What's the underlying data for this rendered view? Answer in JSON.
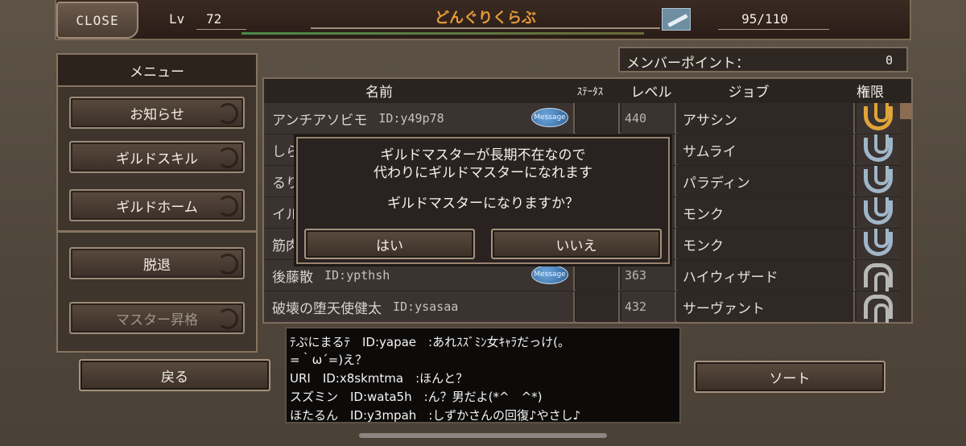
{
  "topbar": {
    "close_label": "CLOSE",
    "lv_label": "Lv",
    "lv_value": "72",
    "guild_name": "どんぐりくらぶ",
    "member_count": "95/110"
  },
  "member_point": {
    "label": "メンバーポイント：",
    "value": "0"
  },
  "menu": {
    "title": "メニュー",
    "items": [
      "お知らせ",
      "ギルドスキル",
      "ギルドホーム"
    ],
    "leave_label": "脱退",
    "promote_label": "マスター昇格",
    "back_label": "戻る"
  },
  "table": {
    "headers": {
      "name": "名前",
      "status": "ｽﾃｰﾀｽ",
      "level": "レベル",
      "job": "ジョブ",
      "rank": "権限"
    },
    "rows": [
      {
        "name": "アンチアソビモ",
        "id": "ID:y49p78",
        "level": "440",
        "job": "アサシン",
        "rank_icon": "gold-guild-rank-icon",
        "message": "Message"
      },
      {
        "name": "しら",
        "id": "",
        "level": "",
        "job": "サムライ",
        "rank_icon": "silver-guild-rank-icon",
        "message": ""
      },
      {
        "name": "るり",
        "id": "",
        "level": "",
        "job": "パラディン",
        "rank_icon": "silver-guild-rank-icon",
        "message": ""
      },
      {
        "name": "イル",
        "id": "",
        "level": "",
        "job": "モンク",
        "rank_icon": "silver-guild-rank-icon",
        "message": ""
      },
      {
        "name": "筋肉",
        "id": "",
        "level": "",
        "job": "モンク",
        "rank_icon": "silver-guild-rank-icon",
        "message": ""
      },
      {
        "name": "後藤散",
        "id": "ID:ypthsh",
        "level": "363",
        "job": "ハイウィザード",
        "rank_icon": "gray-guild-rank-icon",
        "message": "Message"
      },
      {
        "name": "破壊の堕天使健太",
        "id": "ID:ysasaa",
        "level": "432",
        "job": "サーヴァント",
        "rank_icon": "gray-guild-rank-icon",
        "message": ""
      }
    ]
  },
  "dialog": {
    "line1": "ギルドマスターが長期不在なので",
    "line2": "代わりにギルドマスターになれます",
    "question": "ギルドマスターになりますか？",
    "yes_label": "はい",
    "no_label": "いいえ"
  },
  "chat": {
    "lines": [
      "ﾃぷにまるﾃ　ID:yapae　:あれｽｽﾞﾐﾝ女ｷｬﾗだっけ(。",
      " =｀ω´=)え？",
      "URI　ID:x8skmtma　:ほんと？",
      "スズミン　ID:wata5h　:ん？男だよ(*^　^*)",
      "ほたるん　ID:y3mpah　:しずかさんの回復♪やさし♪"
    ]
  },
  "sort_label": "ソート",
  "colors": {
    "guild_name": "#e59b3a",
    "background": "#564c41",
    "panel": "#2a2421"
  }
}
